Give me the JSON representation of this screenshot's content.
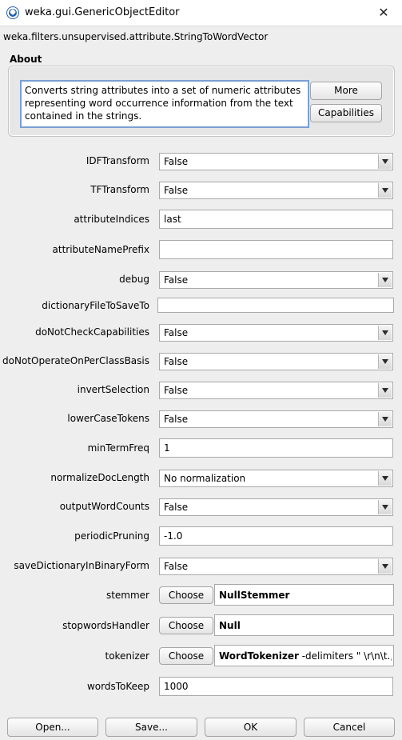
{
  "window": {
    "title": "weka.gui.GenericObjectEditor",
    "close_glyph": "✕"
  },
  "class_name": "weka.filters.unsupervised.attribute.StringToWordVector",
  "about": {
    "label": "About",
    "text_line1": "Converts string attributes into a set of numeric attributes",
    "text_line2": "representing word occurrence information from the text",
    "text_line3": "contained in the strings.",
    "more_button": "More",
    "capabilities_button": "Capabilities"
  },
  "properties": {
    "IDFTransform": {
      "label": "IDFTransform",
      "value": "False"
    },
    "TFTransform": {
      "label": "TFTransform",
      "value": "False"
    },
    "attributeIndices": {
      "label": "attributeIndices",
      "value": "last"
    },
    "attributeNamePrefix": {
      "label": "attributeNamePrefix",
      "value": ""
    },
    "debug": {
      "label": "debug",
      "value": "False"
    },
    "dictionaryFileToSaveTo": {
      "label": "dictionaryFileToSaveTo",
      "value": ""
    },
    "doNotCheckCapabilities": {
      "label": "doNotCheckCapabilities",
      "value": "False"
    },
    "doNotOperateOnPerClassBasis": {
      "label": "doNotOperateOnPerClassBasis",
      "value": "False"
    },
    "invertSelection": {
      "label": "invertSelection",
      "value": "False"
    },
    "lowerCaseTokens": {
      "label": "lowerCaseTokens",
      "value": "False"
    },
    "minTermFreq": {
      "label": "minTermFreq",
      "value": "1"
    },
    "normalizeDocLength": {
      "label": "normalizeDocLength",
      "value": "No normalization"
    },
    "outputWordCounts": {
      "label": "outputWordCounts",
      "value": "False"
    },
    "periodicPruning": {
      "label": "periodicPruning",
      "value": "-1.0"
    },
    "saveDictionaryInBinaryForm": {
      "label": "saveDictionaryInBinaryForm",
      "value": "False"
    },
    "stemmer": {
      "label": "stemmer",
      "choose": "Choose",
      "class": "NullStemmer",
      "options": ""
    },
    "stopwordsHandler": {
      "label": "stopwordsHandler",
      "choose": "Choose",
      "class": "Null",
      "options": ""
    },
    "tokenizer": {
      "label": "tokenizer",
      "choose": "Choose",
      "class": "WordTokenizer",
      "options": " -delimiters \" \\r\\n\\t.,;:\\'\\\"()?"
    },
    "wordsToKeep": {
      "label": "wordsToKeep",
      "value": "1000"
    }
  },
  "footer": {
    "open": "Open...",
    "save": "Save...",
    "ok": "OK",
    "cancel": "Cancel"
  }
}
